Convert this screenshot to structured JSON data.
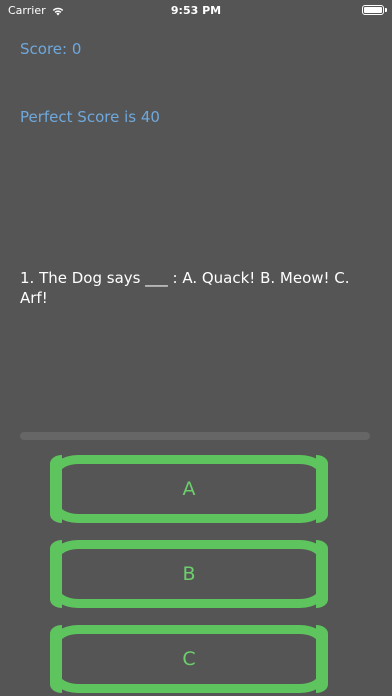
{
  "status_bar": {
    "carrier": "Carrier",
    "time": "9:53 PM",
    "battery_level": 1.0
  },
  "score_label": "Score: 0",
  "perfect_score_label": "Perfect Score is 40",
  "question": "1. The Dog says ___ : A. Quack!  B. Meow! C. Arf!",
  "progress": 0.0,
  "answers": [
    {
      "label": "A"
    },
    {
      "label": "B"
    },
    {
      "label": "C"
    }
  ],
  "colors": {
    "background": "#555555",
    "score_text": "#6fa8dc",
    "button_border": "#5ec45e",
    "button_text": "#6ccf6c"
  }
}
